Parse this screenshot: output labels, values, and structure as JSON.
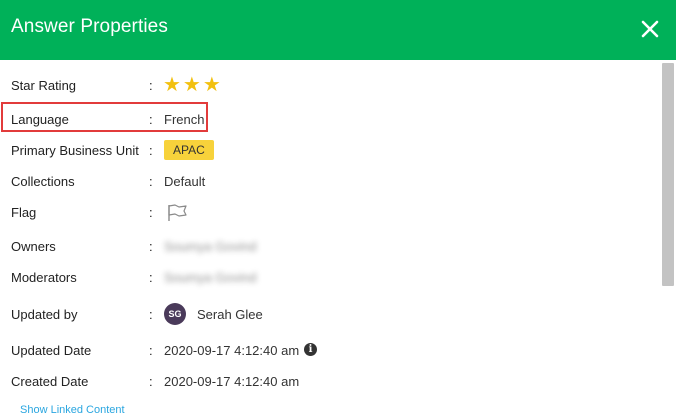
{
  "dialog": {
    "title": "Answer Properties"
  },
  "properties": {
    "star_rating": {
      "label": "Star Rating",
      "stars": "★★★",
      "rating": 3
    },
    "language": {
      "label": "Language",
      "value": "French"
    },
    "primary_business_unit": {
      "label": "Primary Business Unit",
      "value": "APAC"
    },
    "collections": {
      "label": "Collections",
      "value": "Default"
    },
    "flag": {
      "label": "Flag",
      "icon": "flag-icon"
    },
    "owners": {
      "label": "Owners",
      "value": "Soumya Govind"
    },
    "moderators": {
      "label": "Moderators",
      "value": "Soumya Govind"
    },
    "updated_by": {
      "label": "Updated by",
      "avatar_initials": "SG",
      "value": "Serah Glee"
    },
    "updated_date": {
      "label": "Updated Date",
      "value": "2020-09-17 4:12:40 am"
    },
    "created_date": {
      "label": "Created Date",
      "value": "2020-09-17 4:12:40 am"
    }
  },
  "links": {
    "show_linked_content": "Show Linked Content"
  },
  "colors": {
    "header": "#00b159",
    "star": "#f2c00f",
    "badge": "#f7d23b",
    "highlight_border": "#e23b3b",
    "avatar": "#4a3a5a",
    "link": "#2aa6e0"
  },
  "icons": {
    "close": "close-icon",
    "info": "info-icon",
    "flag": "flag-icon"
  }
}
